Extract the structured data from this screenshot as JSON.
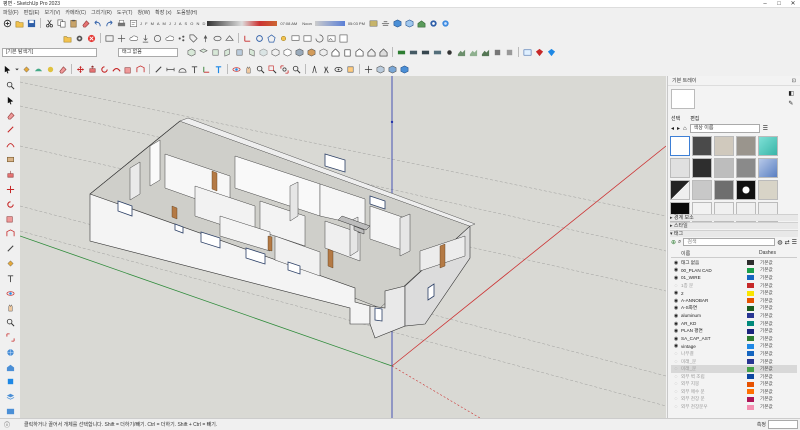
{
  "window": {
    "title": "평면 - SketchUp Pro 2023",
    "min": "–",
    "max": "□",
    "close": "✕"
  },
  "menu": [
    "파일(F)",
    "편집(E)",
    "보기(V)",
    "카메라(C)",
    "그리기(R)",
    "도구(T)",
    "창(W)",
    "확장 (x)",
    "도움말(H)"
  ],
  "shadow": {
    "months": "J F M A M J J A S O N D",
    "time_start": "07:08 AM",
    "time_noon": "Noon",
    "time_end": "05:03 PM"
  },
  "combos": {
    "style": "[기본 탐색기]",
    "layer": "태그 없음"
  },
  "tray": {
    "title": "기본 트레이",
    "material_tabs": [
      "선택",
      "편집"
    ],
    "material_category": "색상 이름",
    "sections": {
      "soften": "▸ 경계 보소",
      "styles": "▸ 스타일",
      "tags": "▾ 태그"
    },
    "search_placeholder": "검색",
    "layer_header": {
      "name": "이름",
      "dashes": "Dashes"
    },
    "layers": [
      {
        "vis": "◉",
        "name": "태그 없음",
        "color": "#2d2d2d",
        "dashes": "기본값",
        "dim": false,
        "sel": false
      },
      {
        "vis": "◉",
        "name": "00_PLAN CAD",
        "color": "#1b9e4b",
        "dashes": "기본값",
        "dim": false,
        "sel": false
      },
      {
        "vis": "◉",
        "name": "01_WIRE",
        "color": "#1565c0",
        "dashes": "기본값",
        "dim": false,
        "sel": false
      },
      {
        "vis": "◌",
        "name": "1층 문",
        "color": "#c62828",
        "dashes": "기본값",
        "dim": true,
        "sel": false
      },
      {
        "vis": "◉",
        "name": "2",
        "color": "#f9e400",
        "dashes": "기본값",
        "dim": false,
        "sel": false
      },
      {
        "vis": "◉",
        "name": "A-ANNOBAR",
        "color": "#e65100",
        "dashes": "기본값",
        "dim": false,
        "sel": false
      },
      {
        "vis": "◉",
        "name": "A-S화면",
        "color": "#1b5e20",
        "dashes": "기본값",
        "dim": false,
        "sel": false
      },
      {
        "vis": "◉",
        "name": "aluminum",
        "color": "#283593",
        "dashes": "기본값",
        "dim": false,
        "sel": false
      },
      {
        "vis": "◉",
        "name": "AR_KD",
        "color": "#00897b",
        "dashes": "기본값",
        "dim": false,
        "sel": false
      },
      {
        "vis": "◉",
        "name": "PLAN 평면",
        "color": "#1a237e",
        "dashes": "기본값",
        "dim": false,
        "sel": false
      },
      {
        "vis": "◉",
        "name": "SA_CAP_AST",
        "color": "#2e7d32",
        "dashes": "기본값",
        "dim": false,
        "sel": false
      },
      {
        "vis": "◉",
        "name": "vintage",
        "color": "#1e88e5",
        "dashes": "기본값",
        "dim": false,
        "sel": false
      },
      {
        "vis": "◌",
        "name": "나무결",
        "color": "#1565c0",
        "dashes": "기본값",
        "dim": true,
        "sel": false
      },
      {
        "vis": "◌",
        "name": "미래_문",
        "color": "#283593",
        "dashes": "기본값",
        "dim": true,
        "sel": false
      },
      {
        "vis": "◌",
        "name": "미래_문",
        "color": "#43a047",
        "dashes": "기본값",
        "dim": true,
        "sel": true
      },
      {
        "vis": "◌",
        "name": "외부 벽 조립",
        "color": "#0d47a1",
        "dashes": "기본값",
        "dim": true,
        "sel": false
      },
      {
        "vis": "◌",
        "name": "외부 지붕",
        "color": "#e65100",
        "dashes": "기본값",
        "dim": true,
        "sel": false
      },
      {
        "vis": "◌",
        "name": "외부 매수 문",
        "color": "#ff6f00",
        "dashes": "기본값",
        "dim": true,
        "sel": false
      },
      {
        "vis": "◌",
        "name": "외부 천장 문",
        "color": "#ad1457",
        "dashes": "기본값",
        "dim": true,
        "sel": false
      },
      {
        "vis": "◌",
        "name": "외부 천장문우",
        "color": "#f48fb1",
        "dashes": "기본값",
        "dim": true,
        "sel": false
      }
    ]
  },
  "status": {
    "hint": "클릭하거나 끌어서 개체를 선택합니다. Shift = 더하기/빼기. Ctrl = 더하기. Shift + Ctrl = 빼기.",
    "measure": "측정"
  }
}
